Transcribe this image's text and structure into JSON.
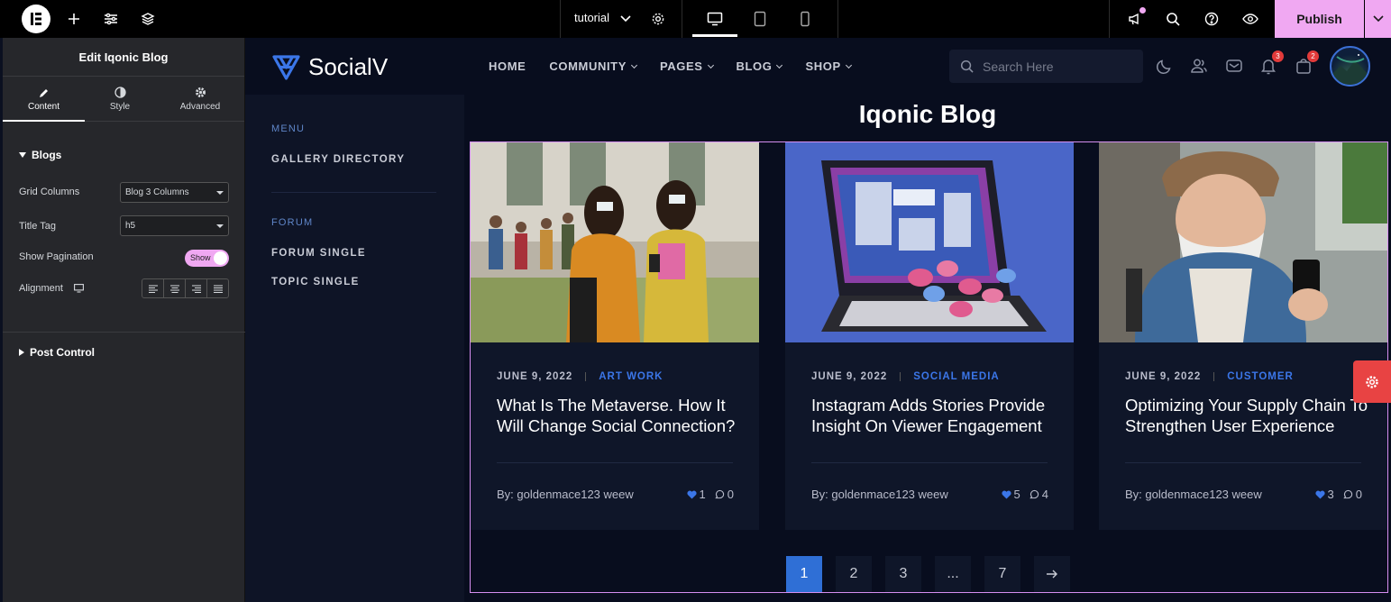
{
  "editor": {
    "page_name": "tutorial",
    "publish_label": "Publish",
    "panel_title": "Edit Iqonic Blog",
    "tabs": [
      {
        "label": "Content",
        "icon": "pencil-icon"
      },
      {
        "label": "Style",
        "icon": "contrast-icon"
      },
      {
        "label": "Advanced",
        "icon": "gear-icon"
      }
    ],
    "sections": {
      "blogs_label": "Blogs",
      "post_control_label": "Post Control"
    },
    "controls": {
      "grid_columns_label": "Grid Columns",
      "grid_columns_value": "Blog 3 Columns",
      "title_tag_label": "Title Tag",
      "title_tag_value": "h5",
      "show_pagination_label": "Show Pagination",
      "show_pagination_value": "Show",
      "alignment_label": "Alignment"
    },
    "accent": "#f0a8f2"
  },
  "site": {
    "brand": "SocialV",
    "nav": [
      {
        "label": "HOME",
        "dropdown": false
      },
      {
        "label": "COMMUNITY",
        "dropdown": true
      },
      {
        "label": "PAGES",
        "dropdown": true
      },
      {
        "label": "BLOG",
        "dropdown": true
      },
      {
        "label": "SHOP",
        "dropdown": true
      }
    ],
    "search_placeholder": "Search Here",
    "notifications_count": "3",
    "cart_count": "2",
    "side_menu": {
      "menu_label": "MENU",
      "gallery_directory": "GALLERY DIRECTORY",
      "forum_label": "FORUM",
      "forum_single": "FORUM SINGLE",
      "topic_single": "TOPIC SINGLE"
    },
    "blog_title": "Iqonic Blog",
    "posts": [
      {
        "date": "JUNE 9, 2022",
        "category": "ART WORK",
        "title": "What Is The Metaverse. How It Will Change Social Connection?",
        "author": "By: goldenmace123 weew",
        "likes": "1",
        "comments": "0"
      },
      {
        "date": "JUNE 9, 2022",
        "category": "SOCIAL MEDIA",
        "title": "Instagram Adds Stories Provide Insight On Viewer Engagement",
        "author": "By: goldenmace123 weew",
        "likes": "5",
        "comments": "4"
      },
      {
        "date": "JUNE 9, 2022",
        "category": "CUSTOMER",
        "title": "Optimizing Your Supply Chain To Strengthen User Experience",
        "author": "By: goldenmace123 weew",
        "likes": "3",
        "comments": "0"
      }
    ],
    "pagination": [
      "1",
      "2",
      "3",
      "...",
      "7"
    ],
    "accent": "#3b76e8"
  }
}
